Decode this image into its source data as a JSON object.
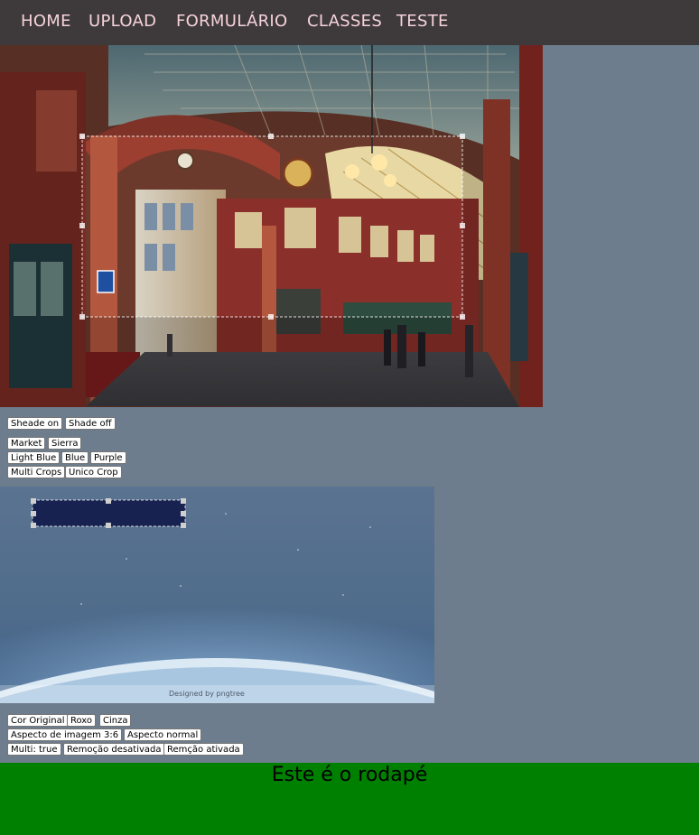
{
  "nav": {
    "items": [
      "HOME",
      "UPLOAD",
      "FORMULÁRIO",
      "CLASSES",
      "TESTE"
    ]
  },
  "crop1": {
    "buttons": {
      "shade_on": "Sheade on",
      "shade_off": "Shade off",
      "market": "Market",
      "sierra": "Sierra",
      "light_blue": "Light Blue",
      "blue": "Blue",
      "purple": "Purple",
      "multi_crops": "Multi Crops",
      "unico_crop": "Unico Crop"
    }
  },
  "crop2": {
    "watermark": "Designed by pngtree",
    "buttons": {
      "cor_original": "Cor Original",
      "roxo": "Roxo",
      "cinza": "Cinza",
      "aspecto_3_6": "Aspecto de imagem 3:6",
      "aspecto_normal": "Aspecto normal",
      "multi_true": "Multi: true",
      "remocao_desativada": "Remoção desativada",
      "remcao_ativada": "Remção ativada"
    }
  },
  "footer": {
    "text": "Este é o rodapé"
  },
  "colors": {
    "nav_bg": "#3e3a3b",
    "nav_text": "#f6d2dc",
    "page_bg": "#6e7d8d",
    "footer_bg": "#008000"
  }
}
